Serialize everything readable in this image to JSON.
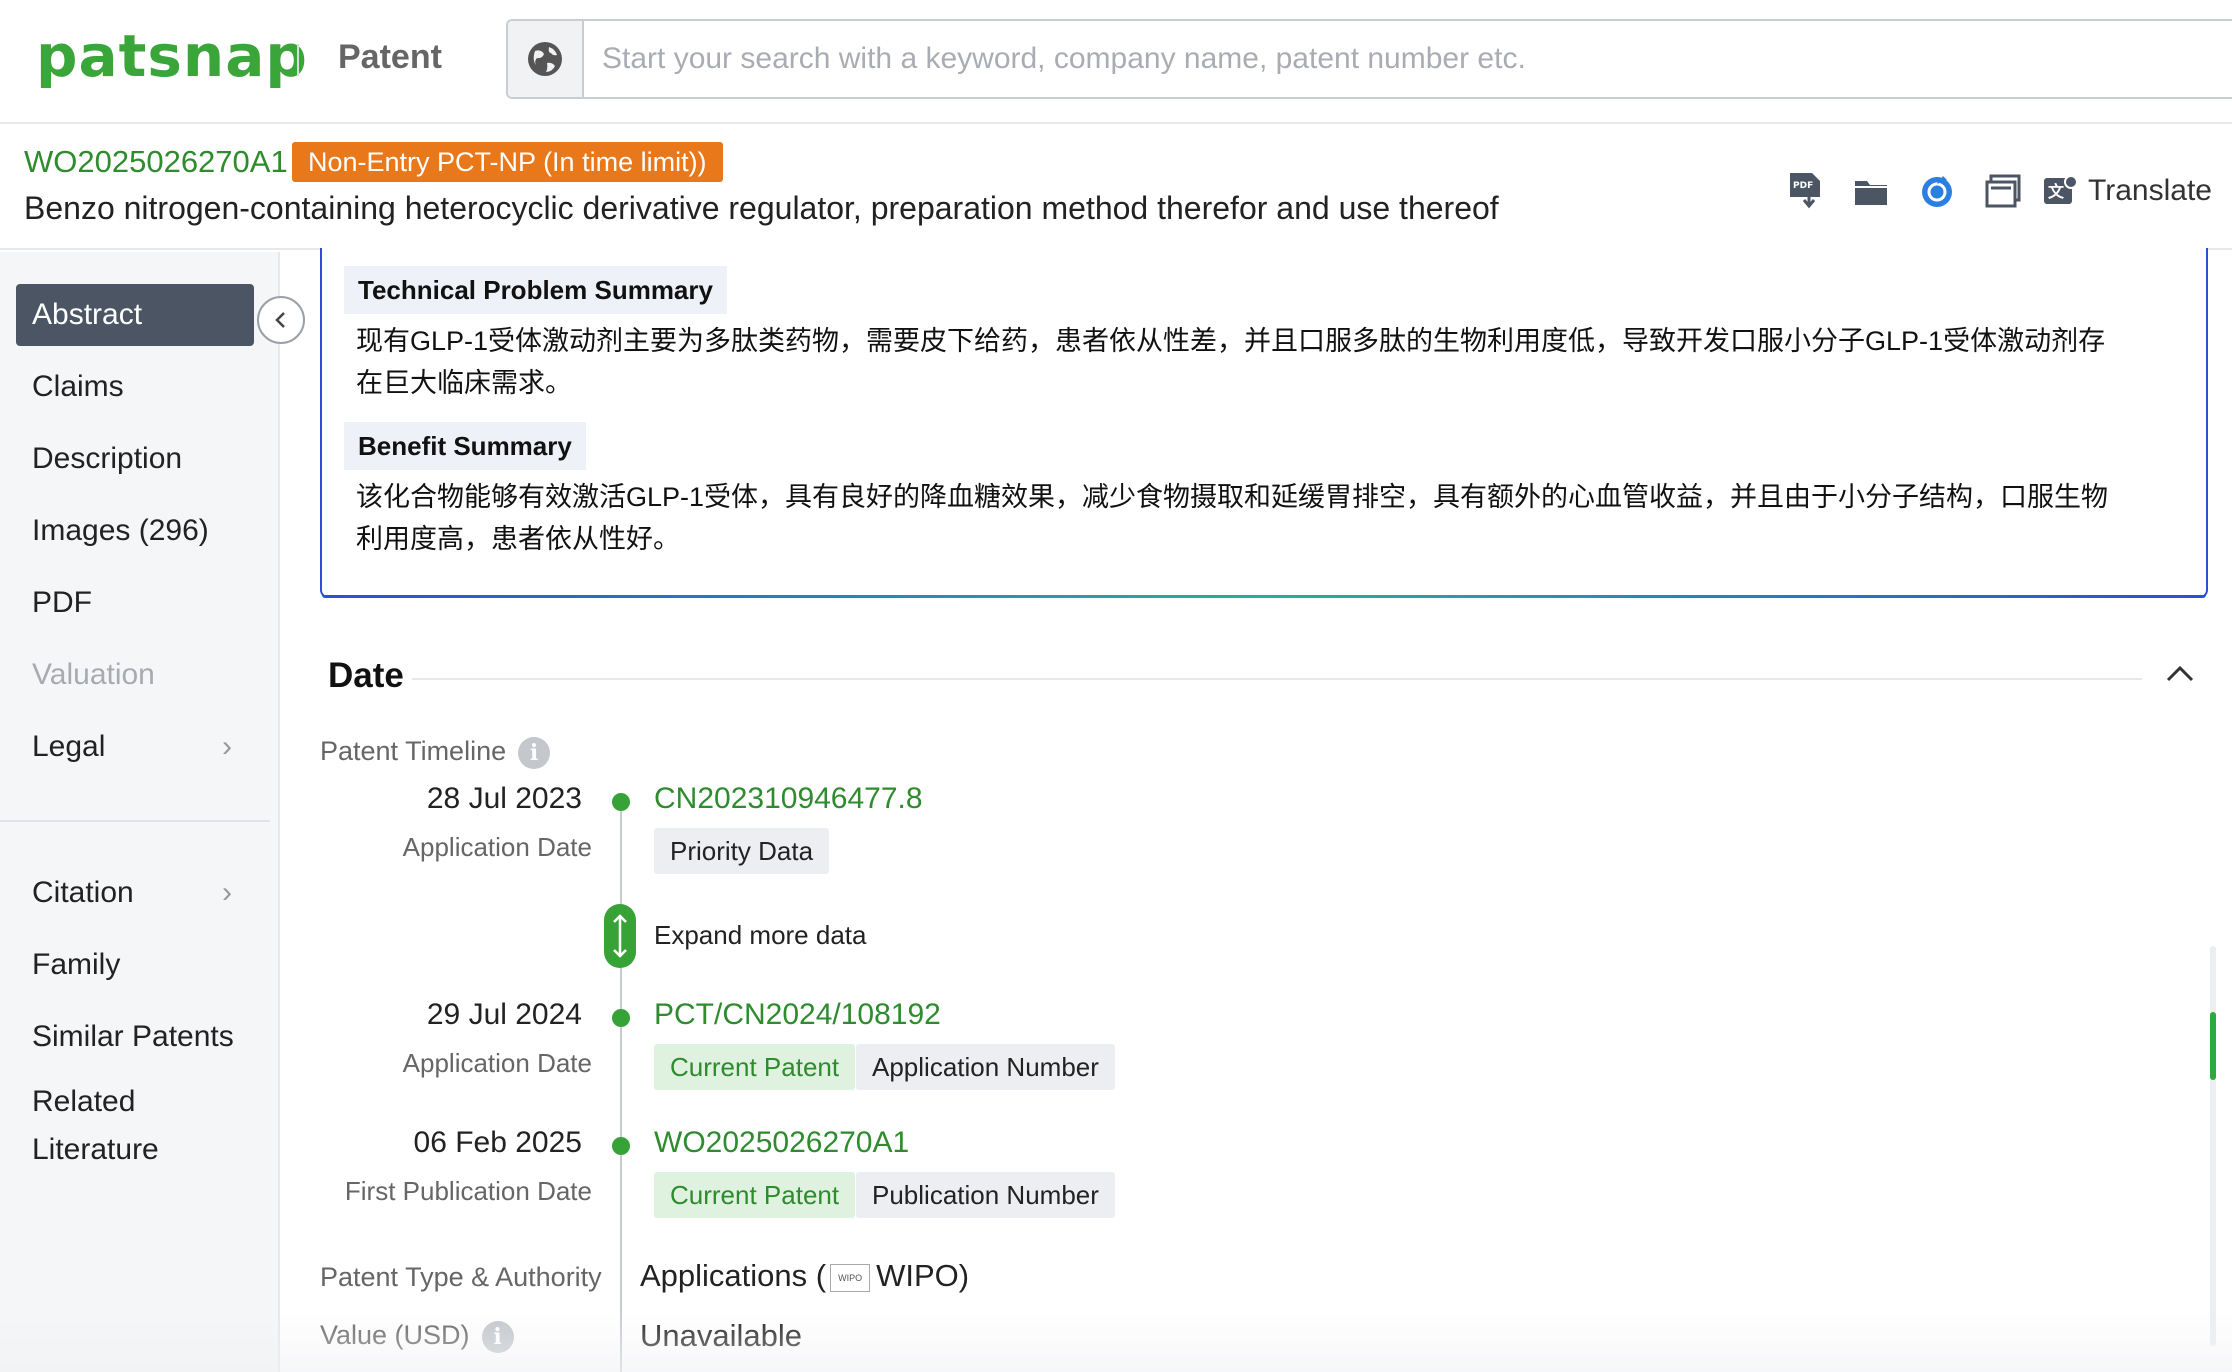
{
  "header": {
    "logo": "patsnap",
    "product": "Patent",
    "search_placeholder": "Start your search with a keyword, company name, patent number etc."
  },
  "patent": {
    "number": "WO2025026270A1",
    "status": "Non-Entry PCT-NP (In time limit))",
    "title": "Benzo nitrogen-containing heterocyclic derivative regulator, preparation method therefor and use thereof"
  },
  "toolbar": {
    "icons": [
      "pdf-download-icon",
      "folder-icon",
      "monitor-alert-icon",
      "compare-icon",
      "translate-icon"
    ],
    "translate_label": "Translate"
  },
  "sidebar": {
    "items": [
      {
        "label": "Abstract"
      },
      {
        "label": "Claims"
      },
      {
        "label": "Description"
      },
      {
        "label": "Images (296)"
      },
      {
        "label": "PDF"
      },
      {
        "label": "Valuation"
      },
      {
        "label": "Legal"
      },
      {
        "label": "Citation"
      },
      {
        "label": "Family"
      },
      {
        "label": "Similar Patents"
      },
      {
        "label": "Related"
      },
      {
        "label": "Literature"
      }
    ]
  },
  "summary": {
    "problem_heading": "Technical Problem Summary",
    "problem_line1": "现有GLP-1受体激动剂主要为多肽类药物，需要皮下给药，患者依从性差，并且口服多肽的生物利用度低，导致开发口服小分子GLP-1受体激动剂存",
    "problem_line2": "在巨大临床需求。",
    "benefit_heading": "Benefit Summary",
    "benefit_line1": "该化合物能够有效激活GLP-1受体，具有良好的降血糖效果，减少食物摄取和延缓胃排空，具有额外的心血管收益，并且由于小分子结构，口服生物",
    "benefit_line2": "利用度高，患者依从性好。"
  },
  "date_section": {
    "title": "Date",
    "timeline_label": "Patent Timeline",
    "entries": [
      {
        "date": "28 Jul 2023",
        "kind": "Application Date",
        "number": "CN202310946477.8",
        "tags": [
          "Priority Data"
        ]
      },
      {
        "date": "29 Jul 2024",
        "kind": "Application Date",
        "number": "PCT/CN2024/108192",
        "tags": [
          "Current Patent",
          "Application Number"
        ]
      },
      {
        "date": "06 Feb 2025",
        "kind": "First Publication Date",
        "number": "WO2025026270A1",
        "tags": [
          "Current Patent",
          "Publication Number"
        ]
      }
    ],
    "expand_label": "Expand more data",
    "type_label": "Patent Type & Authority",
    "type_value_pre": "Applications (",
    "type_logo": "WIPO",
    "type_value_post": "WIPO)",
    "value_label": "Value (USD)",
    "value_value": "Unavailable"
  },
  "colors": {
    "brand_green": "#3aa63a",
    "status_orange": "#e9781a",
    "active_nav": "#4b5563",
    "summary_border": "#2b4fd9"
  }
}
